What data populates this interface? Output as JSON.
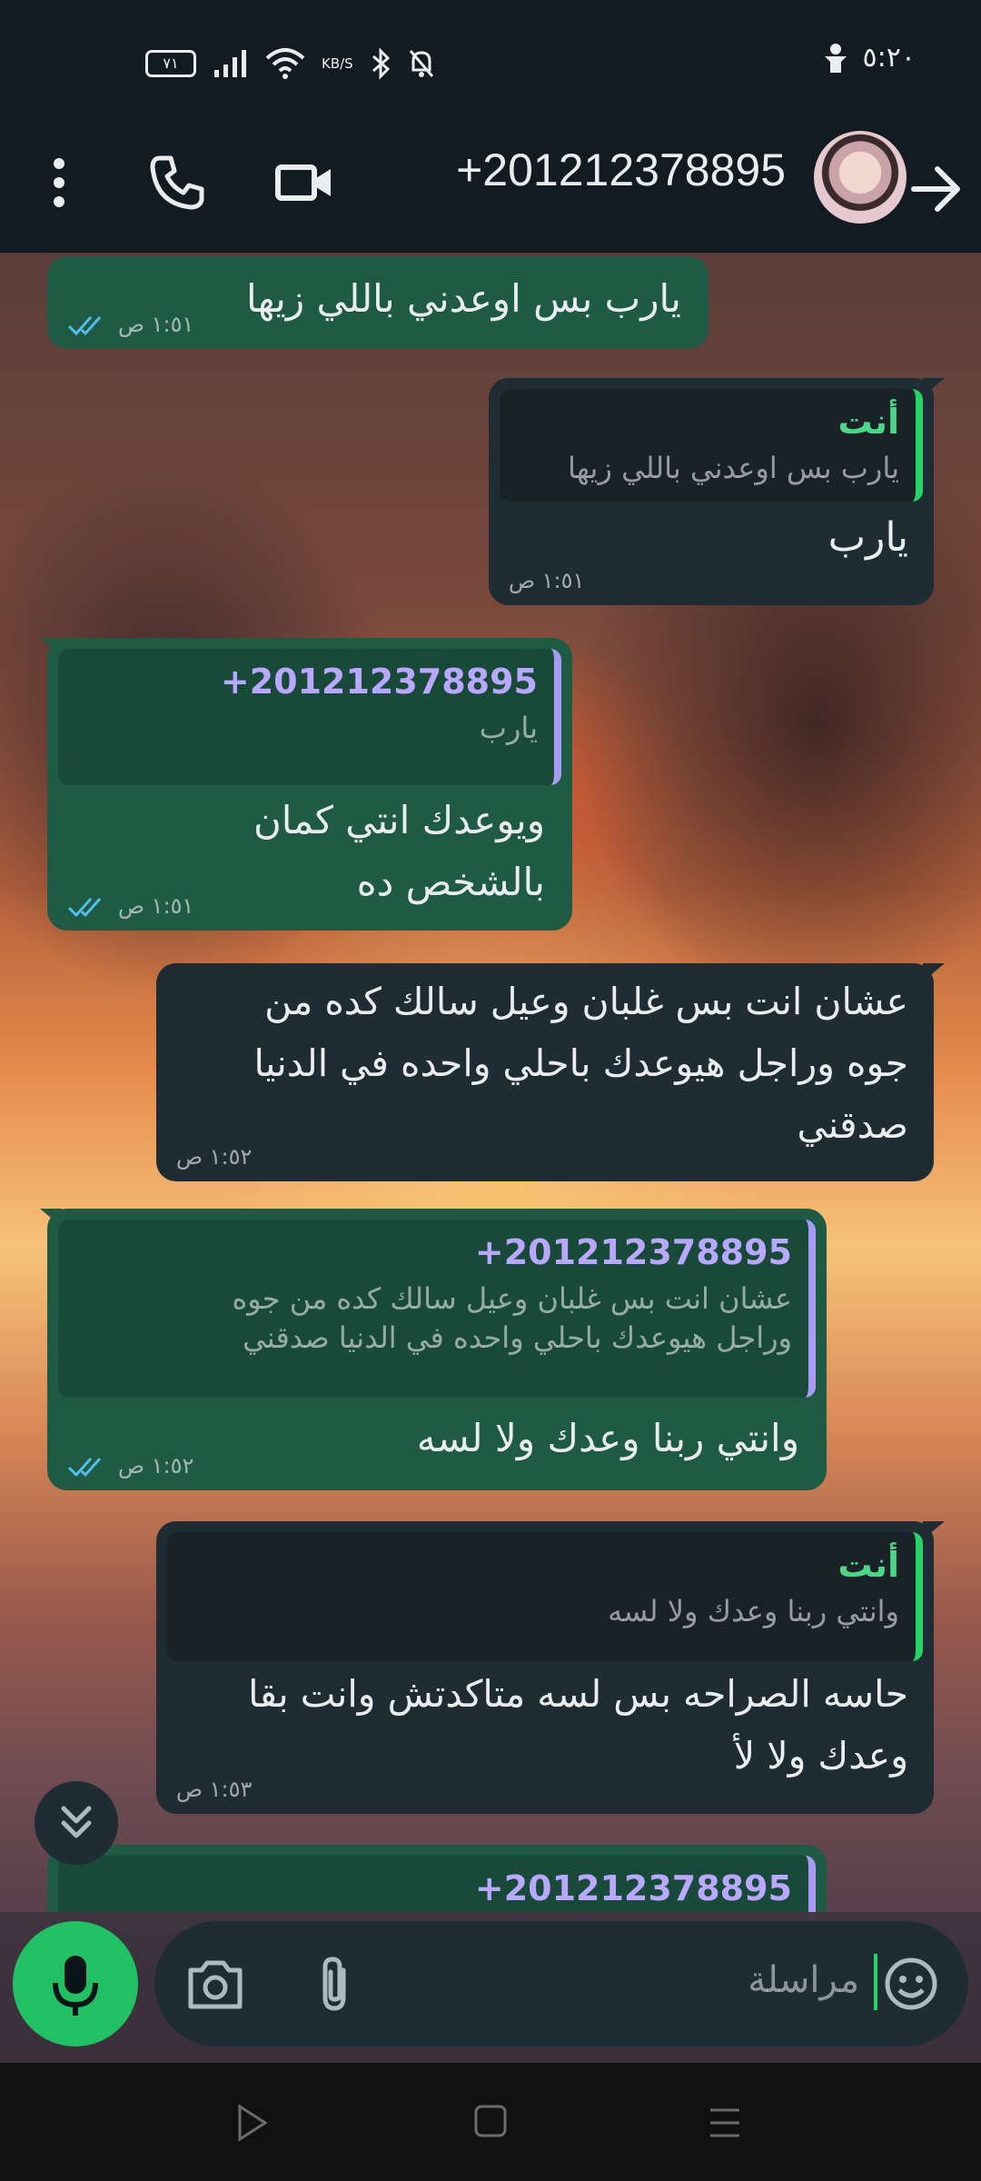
{
  "status_bar": {
    "time": "٥:٢٠",
    "battery": "٧١",
    "speed_unit": "KB/S"
  },
  "header": {
    "title": "+201212378895"
  },
  "messages": [
    {
      "type": "out",
      "text": "يارب بس اوعدني باللي زيها",
      "time": "١:٥١ ص"
    },
    {
      "type": "in",
      "quote_name": "أنت",
      "quote_text": "يارب بس اوعدني باللي زيها",
      "text": "يارب",
      "time": "١:٥١ ص"
    },
    {
      "type": "out",
      "quote_name": "+201212378895",
      "quote_text": "يارب",
      "text_line1": "ويوعدك انتي كمان",
      "text_line2": "بالشخص ده",
      "time": "١:٥١ ص"
    },
    {
      "type": "in",
      "text_line1": "عشان انت بس غلبان وعيل سالك كده من",
      "text_line2": "جوه وراجل هيوعدك باحلي واحده في الدنيا",
      "text_line3": "صدقني",
      "time": "١:٥٢ ص"
    },
    {
      "type": "out",
      "quote_name": "+201212378895",
      "quote_line1": "عشان انت بس غلبان وعيل سالك كده من جوه",
      "quote_line2": "وراجل هيوعدك باحلي واحده في الدنيا صدقني",
      "text": "وانتي ربنا وعدك ولا لسه",
      "time": "١:٥٢ ص"
    },
    {
      "type": "in",
      "quote_name": "أنت",
      "quote_text": "وانتي ربنا وعدك ولا لسه",
      "text_line1": "حاسه الصراحه بس لسه متاكدتش وانت بقا",
      "text_line2": "وعدك ولا لأ",
      "time": "١:٥٣ ص"
    },
    {
      "type": "out",
      "quote_name": "+201212378895"
    }
  ],
  "composer": {
    "placeholder": "مراسلة"
  },
  "colors": {
    "outgoing_bubble": "#1f5a45",
    "incoming_bubble": "#202c33",
    "accent": "#21c063",
    "read_ticks": "#53bdeb"
  },
  "icons": [
    "back-arrow-icon",
    "video-call-icon",
    "voice-call-icon",
    "menu-icon",
    "mic-icon",
    "camera-icon",
    "attach-icon",
    "emoji-icon",
    "scroll-down-icon"
  ]
}
